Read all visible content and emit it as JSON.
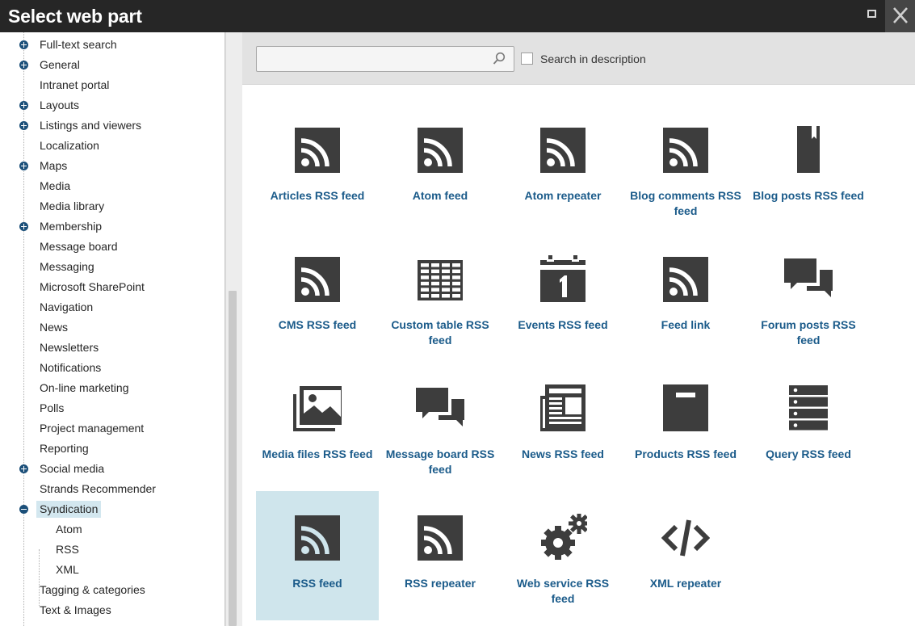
{
  "window": {
    "title": "Select web part",
    "maximize_icon": "maximize-icon",
    "close_icon": "close-icon"
  },
  "tree": {
    "items": [
      {
        "label": "Full-text search",
        "expander": "plus"
      },
      {
        "label": "General",
        "expander": "plus"
      },
      {
        "label": "Intranet portal",
        "expander": ""
      },
      {
        "label": "Layouts",
        "expander": "plus"
      },
      {
        "label": "Listings and viewers",
        "expander": "plus"
      },
      {
        "label": "Localization",
        "expander": ""
      },
      {
        "label": "Maps",
        "expander": "plus"
      },
      {
        "label": "Media",
        "expander": ""
      },
      {
        "label": "Media library",
        "expander": ""
      },
      {
        "label": "Membership",
        "expander": "plus"
      },
      {
        "label": "Message board",
        "expander": ""
      },
      {
        "label": "Messaging",
        "expander": ""
      },
      {
        "label": "Microsoft SharePoint",
        "expander": ""
      },
      {
        "label": "Navigation",
        "expander": ""
      },
      {
        "label": "News",
        "expander": ""
      },
      {
        "label": "Newsletters",
        "expander": ""
      },
      {
        "label": "Notifications",
        "expander": ""
      },
      {
        "label": "On-line marketing",
        "expander": ""
      },
      {
        "label": "Polls",
        "expander": ""
      },
      {
        "label": "Project management",
        "expander": ""
      },
      {
        "label": "Reporting",
        "expander": ""
      },
      {
        "label": "Social media",
        "expander": "plus"
      },
      {
        "label": "Strands Recommender",
        "expander": ""
      },
      {
        "label": "Syndication",
        "expander": "minus",
        "selected": true
      },
      {
        "label": "Atom",
        "expander": "",
        "child": true
      },
      {
        "label": "RSS",
        "expander": "",
        "child": true
      },
      {
        "label": "XML",
        "expander": "",
        "child": true
      },
      {
        "label": "Tagging & categories",
        "expander": ""
      },
      {
        "label": "Text & Images",
        "expander": ""
      }
    ]
  },
  "search": {
    "value": "",
    "placeholder": "",
    "icon": "search-icon",
    "in_description_label": "Search in description",
    "in_description_checked": false
  },
  "webparts": [
    {
      "label": "Articles RSS feed",
      "icon": "rss-icon"
    },
    {
      "label": "Atom feed",
      "icon": "rss-icon"
    },
    {
      "label": "Atom repeater",
      "icon": "rss-icon"
    },
    {
      "label": "Blog comments RSS feed",
      "icon": "rss-icon"
    },
    {
      "label": "Blog posts RSS feed",
      "icon": "bookmark-icon"
    },
    {
      "label": "CMS RSS feed",
      "icon": "rss-icon"
    },
    {
      "label": "Custom table RSS feed",
      "icon": "table-icon"
    },
    {
      "label": "Events RSS feed",
      "icon": "calendar-icon"
    },
    {
      "label": "Feed link",
      "icon": "rss-icon"
    },
    {
      "label": "Forum posts RSS feed",
      "icon": "chat-bubbles-icon"
    },
    {
      "label": "Media files RSS feed",
      "icon": "image-stack-icon"
    },
    {
      "label": "Message board RSS feed",
      "icon": "chat-bubbles-icon"
    },
    {
      "label": "News RSS feed",
      "icon": "newspaper-icon"
    },
    {
      "label": "Products RSS feed",
      "icon": "product-box-icon"
    },
    {
      "label": "Query RSS feed",
      "icon": "server-icon"
    },
    {
      "label": "RSS feed",
      "icon": "rss-icon",
      "selected": true
    },
    {
      "label": "RSS repeater",
      "icon": "rss-icon"
    },
    {
      "label": "Web service RSS feed",
      "icon": "gears-icon"
    },
    {
      "label": "XML repeater",
      "icon": "code-icon"
    }
  ],
  "colors": {
    "titlebar": "#262626",
    "icon_dark": "#3d3d3d",
    "label_blue": "#1b5b8a",
    "selected_tile": "#cfe5ec",
    "expander_blue": "#1b4f79"
  }
}
